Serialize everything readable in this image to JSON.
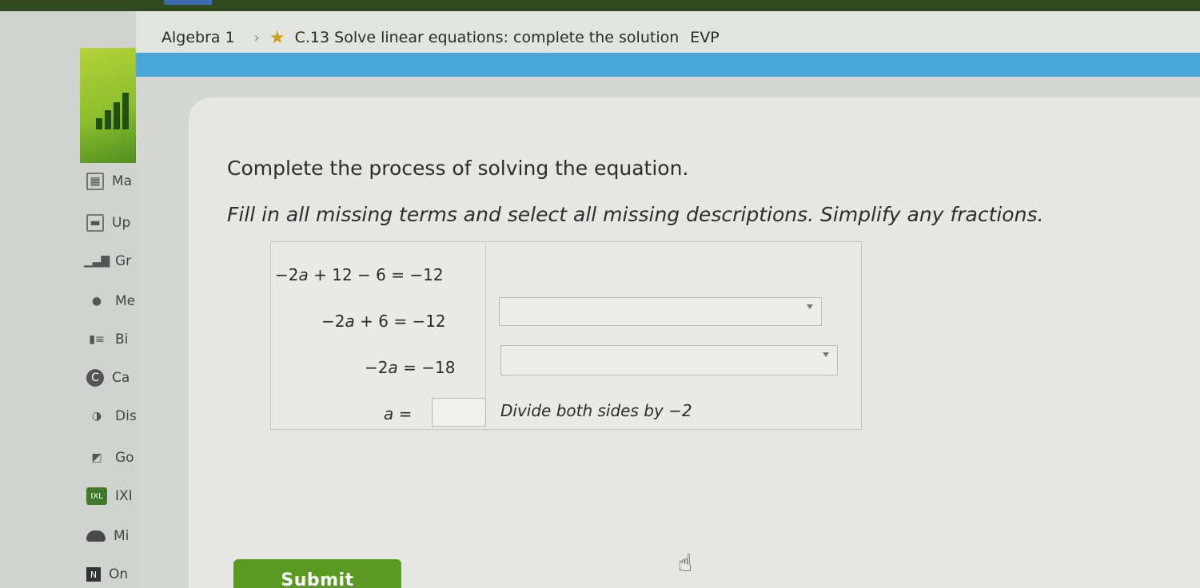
{
  "breadcrumb": {
    "course": "Algebra 1",
    "skill": "C.13 Solve linear equations: complete the solution",
    "code": "EVP"
  },
  "sidebar": {
    "items": [
      {
        "label": "Ma",
        "icon": "calculator-icon"
      },
      {
        "label": "Up",
        "icon": "document-icon"
      },
      {
        "label": "Gr",
        "icon": "chart-icon"
      },
      {
        "label": "Me",
        "icon": "person-icon"
      },
      {
        "label": "Bi",
        "icon": "big-ideas-icon"
      },
      {
        "label": "Ca",
        "icon": "circle-c-icon"
      },
      {
        "label": "Dis",
        "icon": "discover-icon"
      },
      {
        "label": "Go",
        "icon": "gallery-icon"
      },
      {
        "label": "IXI",
        "icon": "ixl-icon"
      },
      {
        "label": "Mi",
        "icon": "cloud-icon"
      },
      {
        "label": "On",
        "icon": "onenote-icon"
      }
    ]
  },
  "question": {
    "prompt": "Complete the process of solving the equation.",
    "instruction": "Fill in all missing terms and select all missing descriptions. Simplify any fractions."
  },
  "equations": {
    "row1": {
      "c1": "−2",
      "v1": "a",
      "op1": "+",
      "c2": "12",
      "op2": "−",
      "c3": "6",
      "eq": "=",
      "rhs": "−12"
    },
    "row2": {
      "c1": "−2",
      "v1": "a",
      "op1": "+",
      "c2": "6",
      "eq": "=",
      "rhs": "−12"
    },
    "row3": {
      "c1": "−2",
      "v1": "a",
      "eq": "=",
      "rhs": "−18"
    },
    "row4": {
      "v1": "a",
      "eq": "=",
      "description": "Divide both sides by −2"
    }
  },
  "submit_label": "Submit",
  "colors": {
    "accent_blue": "#4aa6d8",
    "submit_green": "#5a9a22",
    "star": "#c9a01a"
  }
}
